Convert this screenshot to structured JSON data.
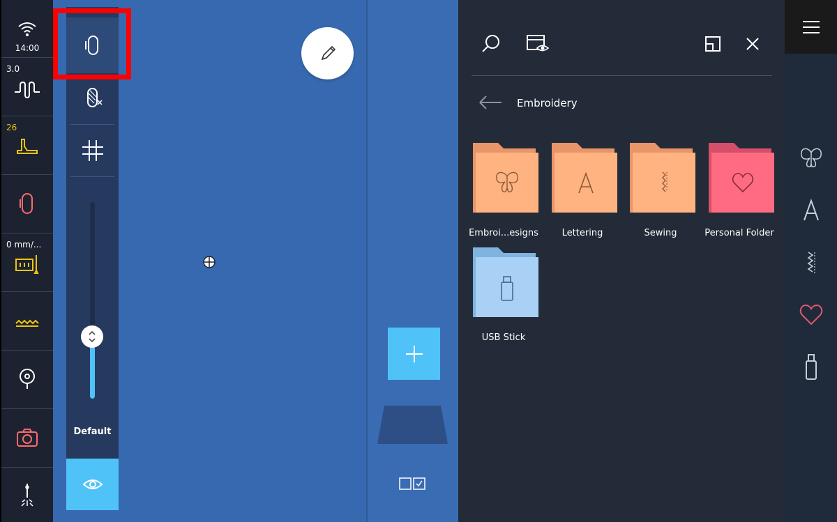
{
  "status_bar": {
    "time": "14:00",
    "stitch_width": "3.0",
    "stitch_length": "26",
    "feed": "0 mm/..."
  },
  "hoop_tools": {
    "mode_label": "Default"
  },
  "browser": {
    "breadcrumb": "Embroidery",
    "folders": [
      {
        "label": "Embroi...esigns",
        "icon": "butterfly-icon",
        "color": "#ffb380"
      },
      {
        "label": "Lettering",
        "icon": "letter-a-icon",
        "color": "#ffb380"
      },
      {
        "label": "Sewing",
        "icon": "stitch-icon",
        "color": "#ffb380"
      },
      {
        "label": "Personal Folder",
        "icon": "heart-icon",
        "color": "#ff6b81"
      },
      {
        "label": "USB Stick",
        "icon": "usb-icon",
        "color": "#a8d1f5"
      }
    ]
  },
  "colors": {
    "accent": "#4fc3f7",
    "canvas": "#3769b0",
    "panel": "#232b38",
    "highlight": "#ff0000",
    "status_yellow": "#f1c40f",
    "status_red": "#ff6b6b"
  }
}
